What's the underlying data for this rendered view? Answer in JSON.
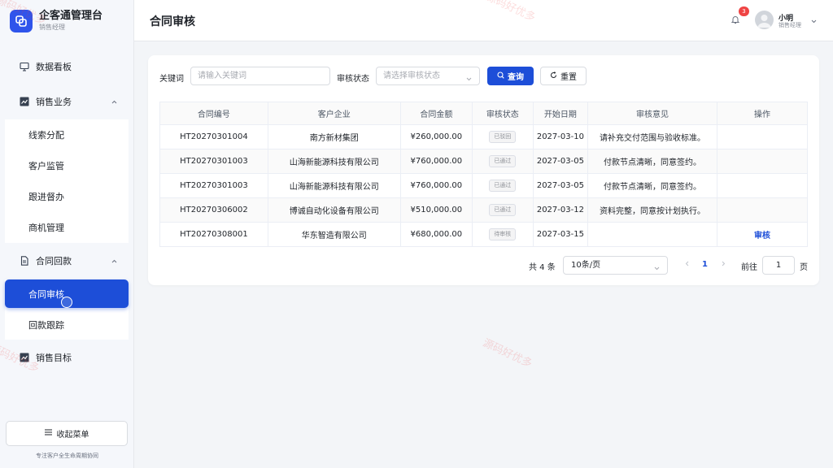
{
  "brand": {
    "title": "企客通管理台",
    "subtitle": "销售经理"
  },
  "sidebar": {
    "items": [
      {
        "label": "数据看板"
      },
      {
        "label": "销售业务",
        "children": [
          "线索分配",
          "客户监管",
          "跟进督办",
          "商机管理"
        ]
      },
      {
        "label": "合同回款",
        "children": [
          "合同审核",
          "回款跟踪"
        ],
        "active_child": "合同审核"
      },
      {
        "label": "销售目标"
      }
    ],
    "collapse_label": "收起菜单",
    "footer": "专注客户全生命周期协同"
  },
  "header": {
    "title": "合同审核",
    "notification_count": "3",
    "user_name": "小明",
    "user_role": "销售经理"
  },
  "filters": {
    "keyword_label": "关键词",
    "keyword_placeholder": "请输入关键词",
    "status_label": "审核状态",
    "status_placeholder": "请选择审核状态",
    "search_label": "查询",
    "reset_label": "重置"
  },
  "table": {
    "columns": [
      "合同编号",
      "客户企业",
      "合同金额",
      "审核状态",
      "开始日期",
      "审核意见",
      "操作"
    ],
    "rows": [
      {
        "id": "HT20270301004",
        "company": "南方新材集团",
        "amount": "¥260,000.00",
        "status": "已驳回",
        "date": "2027-03-10",
        "opinion": "请补充交付范围与验收标准。",
        "action": ""
      },
      {
        "id": "HT20270301003",
        "company": "山海新能源科技有限公司",
        "amount": "¥760,000.00",
        "status": "已通过",
        "date": "2027-03-05",
        "opinion": "付款节点清晰，同意签约。",
        "action": ""
      },
      {
        "id": "HT20270301003",
        "company": "山海新能源科技有限公司",
        "amount": "¥760,000.00",
        "status": "已通过",
        "date": "2027-03-05",
        "opinion": "付款节点清晰，同意签约。",
        "action": ""
      },
      {
        "id": "HT20270306002",
        "company": "博诚自动化设备有限公司",
        "amount": "¥510,000.00",
        "status": "已通过",
        "date": "2027-03-12",
        "opinion": "资料完整，同意按计划执行。",
        "action": ""
      },
      {
        "id": "HT20270308001",
        "company": "华东智造有限公司",
        "amount": "¥680,000.00",
        "status": "待审核",
        "date": "2027-03-15",
        "opinion": "",
        "action": "审核"
      }
    ]
  },
  "pagination": {
    "total": "共 4 条",
    "page_size": "10条/页",
    "current_page": "1",
    "goto_label": "前往",
    "goto_value": "1",
    "page_unit": "页"
  },
  "watermark": "源码好优多",
  "colors": {
    "primary": "#1d4ed8",
    "badge": "#ef4444"
  }
}
